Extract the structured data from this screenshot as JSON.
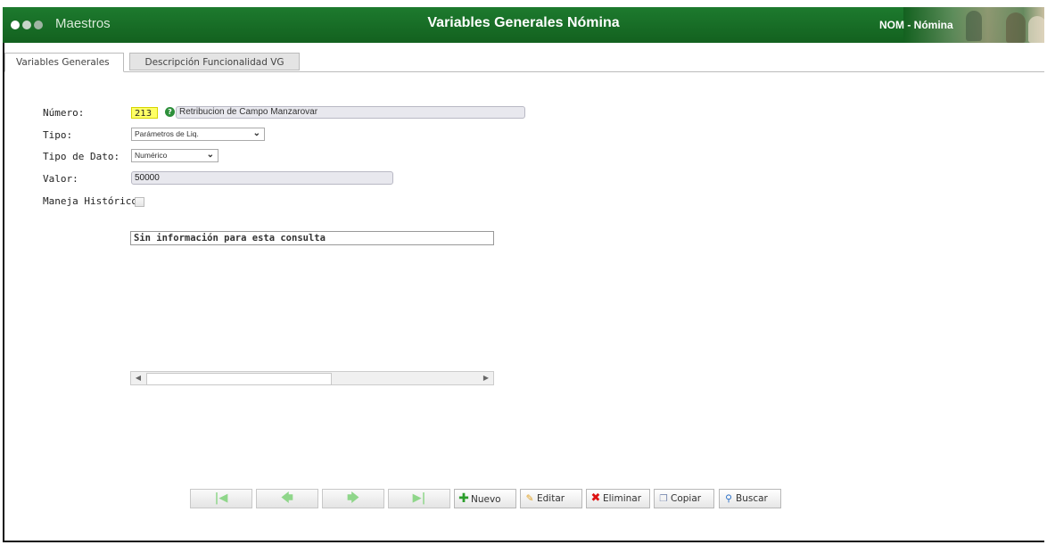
{
  "header": {
    "module_label": "Maestros",
    "title": "Variables Generales Nómina",
    "module_badge": "NOM - Nómina"
  },
  "tabs": [
    {
      "label": "Variables Generales",
      "active": true
    },
    {
      "label": "Descripción Funcionalidad VG",
      "active": false
    }
  ],
  "form": {
    "numero": {
      "label": "Número:",
      "value": "213",
      "description": "Retribucion de Campo Manzarovar"
    },
    "tipo": {
      "label": "Tipo:",
      "value": "Parámetros de Liq."
    },
    "tipo_dato": {
      "label": "Tipo de Dato:",
      "value": "Numérico"
    },
    "valor": {
      "label": "Valor:",
      "value": "50000"
    },
    "maneja_historico": {
      "label": "Maneja Histórico:",
      "checked": false
    }
  },
  "grid": {
    "empty_message": "Sin información para esta consulta"
  },
  "toolbar": {
    "nuevo": "Nuevo",
    "editar": "Editar",
    "eliminar": "Eliminar",
    "copiar": "Copiar",
    "buscar": "Buscar"
  },
  "colors": {
    "header_green": "#1d7a2e",
    "number_highlight": "#ffff66"
  }
}
